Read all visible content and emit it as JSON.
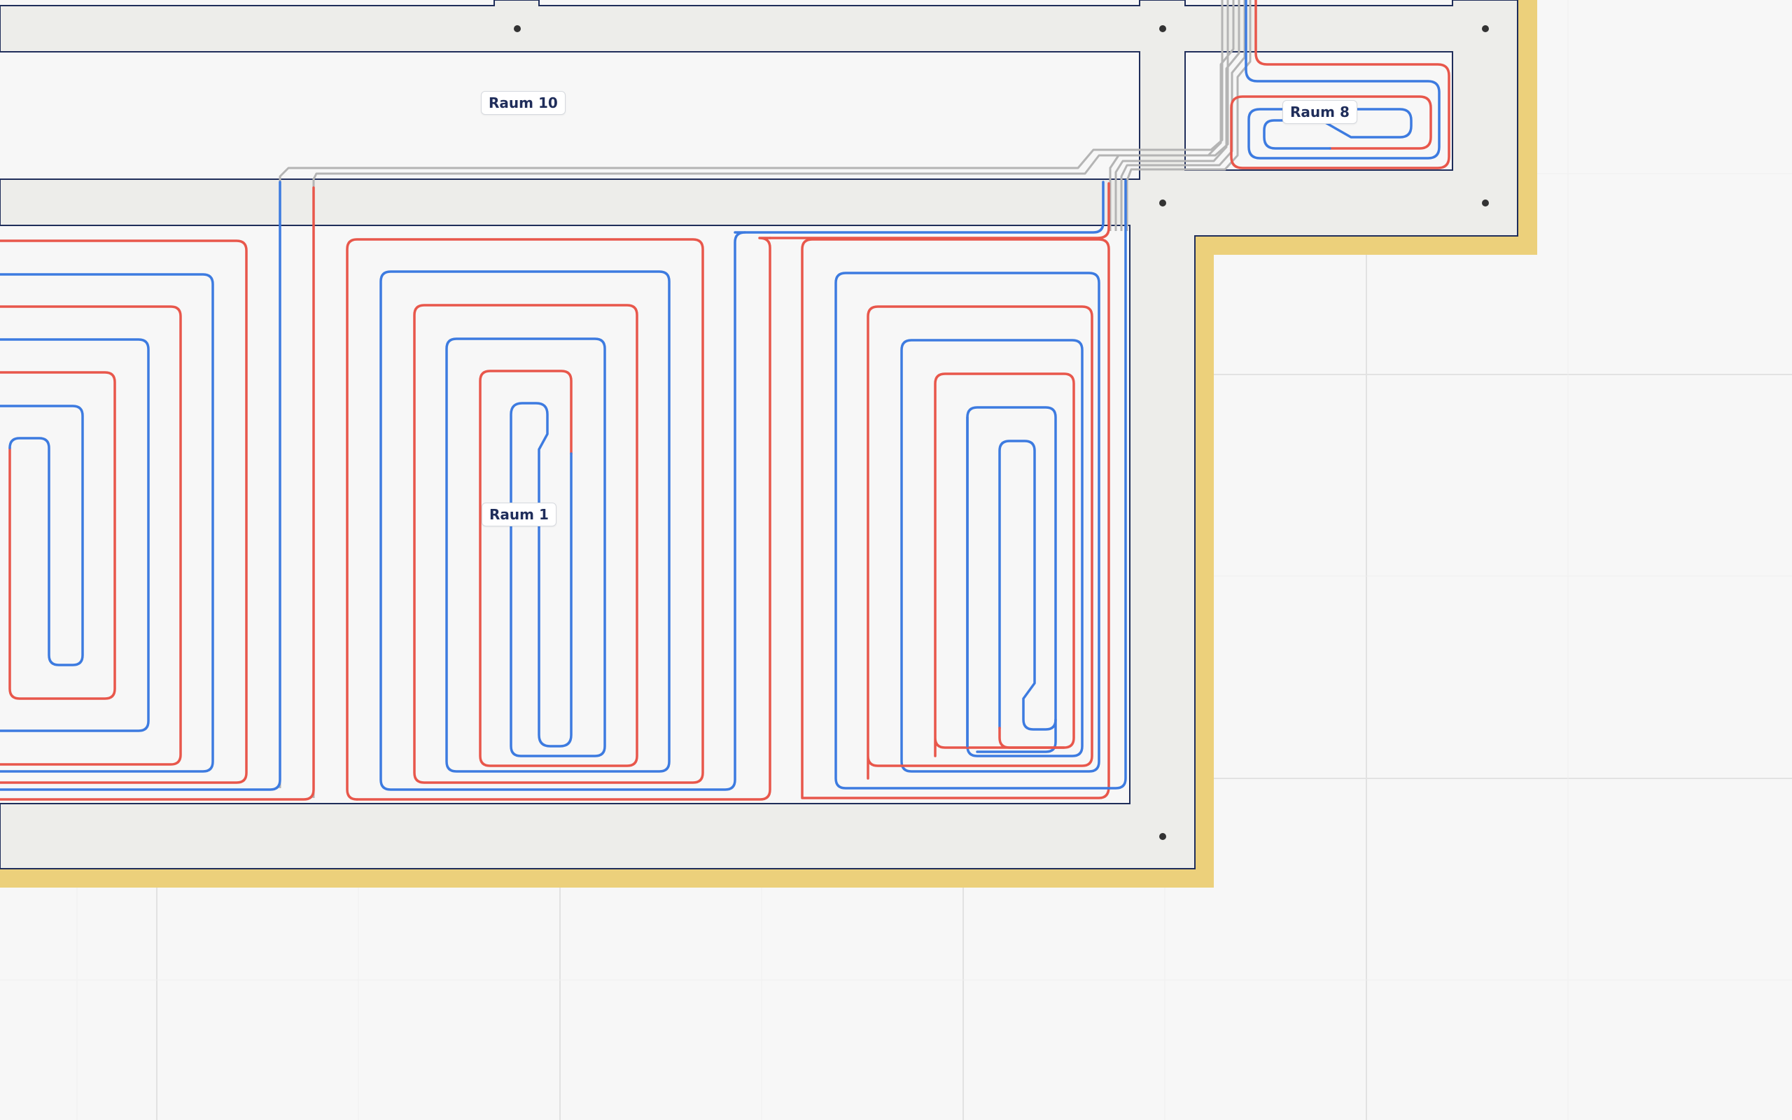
{
  "canvas": {
    "background": "#f7f7f7",
    "grid_color": "#e2e2e2",
    "screed_color": "#ededea",
    "insulation_color": "#ecd07b",
    "room_outline_color": "#1f2d5a",
    "pipe_supply_color": "#e8574b",
    "pipe_return_color": "#3d7be0",
    "feeder_color": "#b4b4b4",
    "anchor_color": "#333333"
  },
  "rooms": [
    {
      "id": "raum-10",
      "label": "Raum 10"
    },
    {
      "id": "raum-1",
      "label": "Raum 1"
    },
    {
      "id": "raum-8",
      "label": "Raum 8"
    }
  ],
  "pipe_icons": {
    "supply": "supply-pipe-icon",
    "return": "return-pipe-icon",
    "feeder": "feeder-line-icon",
    "anchor": "anchor-point-icon"
  }
}
